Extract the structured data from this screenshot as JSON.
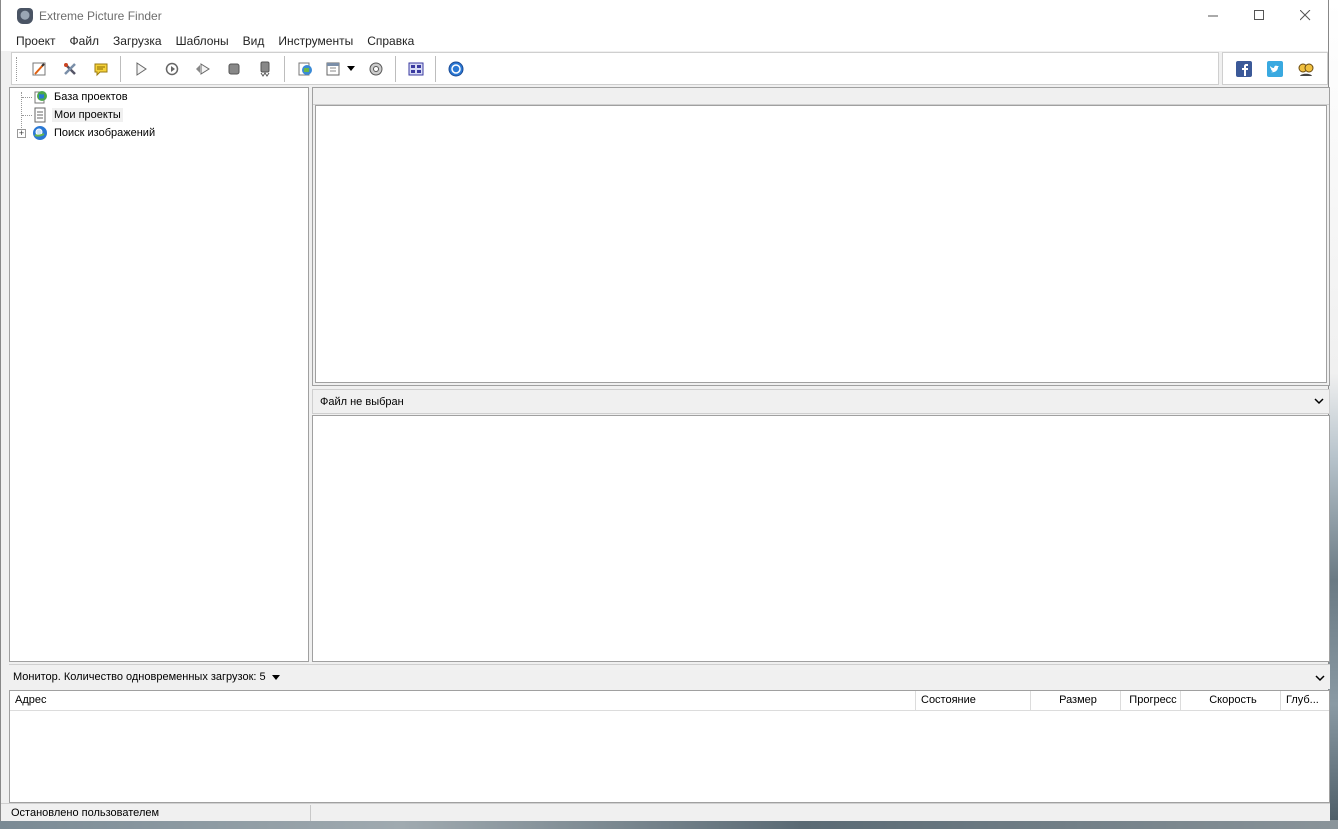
{
  "window": {
    "title": "Extreme Picture Finder"
  },
  "menu": [
    "Проект",
    "Файл",
    "Загрузка",
    "Шаблоны",
    "Вид",
    "Инструменты",
    "Справка"
  ],
  "toolbar": {
    "buttons": [
      "new-project-icon",
      "edit-project-icon",
      "comment-icon",
      "start-icon",
      "refresh-icon",
      "resume-icon",
      "stop-icon",
      "stop-all-icon",
      "browser-icon",
      "view-mode-icon",
      "settings-icon",
      "thumbnails-icon",
      "help-icon"
    ],
    "social": [
      "facebook-icon",
      "twitter-icon",
      "community-icon"
    ]
  },
  "tree": {
    "items": [
      {
        "label": "База проектов",
        "icon": "globe-database-icon"
      },
      {
        "label": "Мои проекты",
        "icon": "projects-icon"
      },
      {
        "label": "Поиск изображений",
        "icon": "search-globe-icon",
        "expandable": true
      }
    ]
  },
  "file_selector": {
    "value": "Файл не выбран"
  },
  "monitor": {
    "label": "Монитор. Количество одновременных загрузок: 5",
    "columns": [
      "Адрес",
      "Состояние",
      "Размер",
      "Прогресс",
      "Скорость",
      "Глуб..."
    ]
  },
  "status": {
    "text": "Остановлено пользователем"
  },
  "colors": {
    "window_bg": "#f0f0f0",
    "pane_bg": "#ffffff",
    "border": "#a0a0a0"
  }
}
